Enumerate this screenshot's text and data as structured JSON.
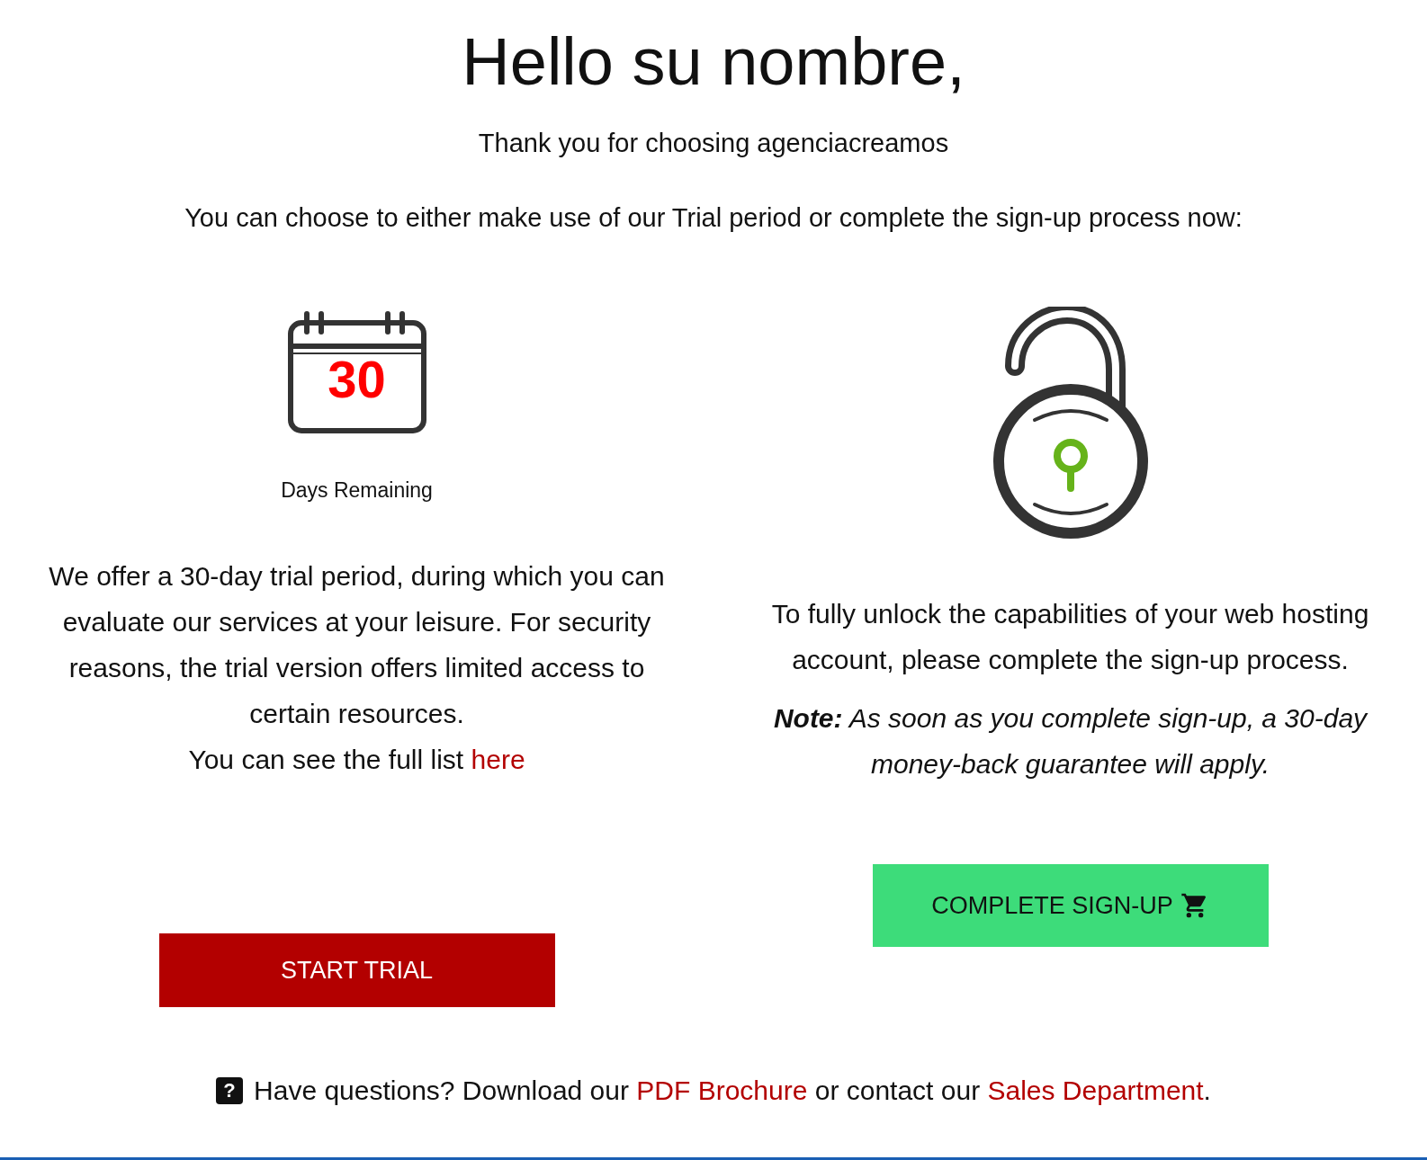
{
  "greeting": "Hello su nombre,",
  "thanks": "Thank you for choosing agenciacreamos",
  "intro": "You can choose to either make use of our Trial period or complete the sign-up process now:",
  "trial": {
    "days": "30",
    "days_label": "Days Remaining",
    "description": "We offer a 30-day trial period, during which you can evaluate our services at your leisure. For security reasons, the trial version offers limited access to certain resources.",
    "list_text": "You can see the full list ",
    "list_link": "here",
    "button": "START TRIAL"
  },
  "signup": {
    "description": "To fully unlock the capabilities of your web hosting account, please complete the sign-up process.",
    "note": "**Note:** As soon as you complete sign-up, a 30-day money-back guarantee will apply.",
    "button": "COMPLETE SIGN-UP"
  },
  "footer": {
    "icon_text": "?",
    "parts": [
      {
        "kind": "text",
        "text": "Have questions? Download our "
      },
      {
        "kind": "link",
        "text": "PDF Brochure"
      },
      {
        "kind": "text",
        "text": " or contact our "
      },
      {
        "kind": "link",
        "text": "Sales Department"
      },
      {
        "kind": "text",
        "text": "."
      }
    ]
  }
}
